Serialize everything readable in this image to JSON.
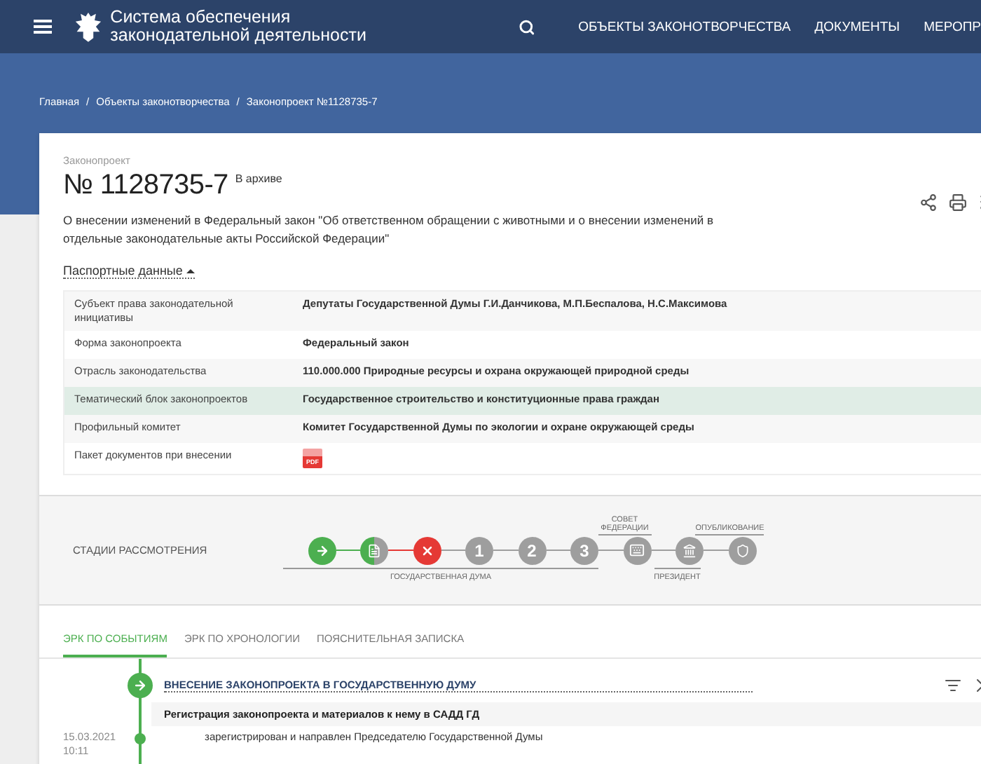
{
  "header": {
    "title_line1": "Система обеспечения",
    "title_line2": "законодательной деятельности",
    "nav": [
      "ОБЪЕКТЫ ЗАКОНОТВОРЧЕСТВА",
      "ДОКУМЕНТЫ",
      "МЕРОПР"
    ]
  },
  "breadcrumbs": [
    {
      "text": "Главная",
      "separator": "/"
    },
    {
      "text": "Объекты законотворчества",
      "separator": "/"
    },
    {
      "text": "Законопроект №1128735-7"
    }
  ],
  "bill": {
    "caption": "Законопроект",
    "number": "№ 1128735-7",
    "status": "В архиве",
    "description": "О внесении изменений в Федеральный закон \"Об ответственном обращении с животными и о внесении изменений в отдельные законодательные акты Российской Федерации\"",
    "passport_toggle": "Паспортные данные",
    "expanded": true
  },
  "passport": [
    {
      "kind": "text",
      "label": "Субъект права законодательной инициативы",
      "value": "Депутаты Государственной Думы Г.И.Данчикова, М.П.Беспалова, Н.С.Максимова",
      "highlighted": false
    },
    {
      "kind": "text",
      "label": "Форма законопроекта",
      "value": "Федеральный закон",
      "highlighted": false
    },
    {
      "kind": "text",
      "label": "Отрасль законодательства",
      "value": "110.000.000 Природные ресурсы и охрана окружающей природной среды",
      "highlighted": false
    },
    {
      "kind": "text",
      "label": "Тематический блок законопроектов",
      "value": "Государственное строительство и конституционные права граждан",
      "highlighted": true
    },
    {
      "kind": "text",
      "label": "Профильный комитет",
      "value": "Комитет Государственной Думы по экологии и охране окружающей среды",
      "highlighted": false
    },
    {
      "kind": "file",
      "label": "Пакет документов при внесении",
      "value": "PDF",
      "highlighted": false
    }
  ],
  "stages": {
    "title": "СТАДИИ РАССМОТРЕНИЯ",
    "groups": [
      {
        "label": "ГОСУДАРСТВЕННАЯ ДУМА",
        "kind": "below",
        "stages": [
          {
            "kind": "done"
          },
          {
            "kind": "partial"
          },
          {
            "kind": "rejected"
          },
          {
            "kind": "pending",
            "number": "1"
          },
          {
            "kind": "pending",
            "number": "2"
          },
          {
            "kind": "pending",
            "number": "3"
          }
        ]
      },
      {
        "label": "СОВЕТ ФЕДЕРАЦИИ",
        "kind": "above",
        "stages": [
          {
            "kind": "pending"
          }
        ]
      },
      {
        "label": "ПРЕЗИДЕНТ",
        "kind": "below",
        "stages": [
          {
            "kind": "pending"
          }
        ]
      },
      {
        "label": "ОПУБЛИКОВАНИЕ",
        "kind": "above",
        "stages": [
          {
            "kind": "pending"
          }
        ]
      }
    ]
  },
  "tabs": [
    {
      "label": "ЭРК ПО СОБЫТИЯМ",
      "selected": true
    },
    {
      "label": "ЭРК ПО ХРОНОЛОГИИ",
      "selected": false
    },
    {
      "label": "ПОЯСНИТЕЛЬНАЯ ЗАПИСКА",
      "selected": false
    }
  ],
  "timeline": {
    "stage_title": "ВНЕСЕНИЕ ЗАКОНОПРОЕКТА В ГОСУДАРСТВЕННУЮ ДУМУ",
    "event_title": "Регистрация законопроекта и материалов к нему в САДД ГД",
    "entries": [
      {
        "date": "15.03.2021",
        "time": "10:11",
        "text": "зарегистрирован и направлен Председателю Государственной Думы"
      }
    ]
  }
}
